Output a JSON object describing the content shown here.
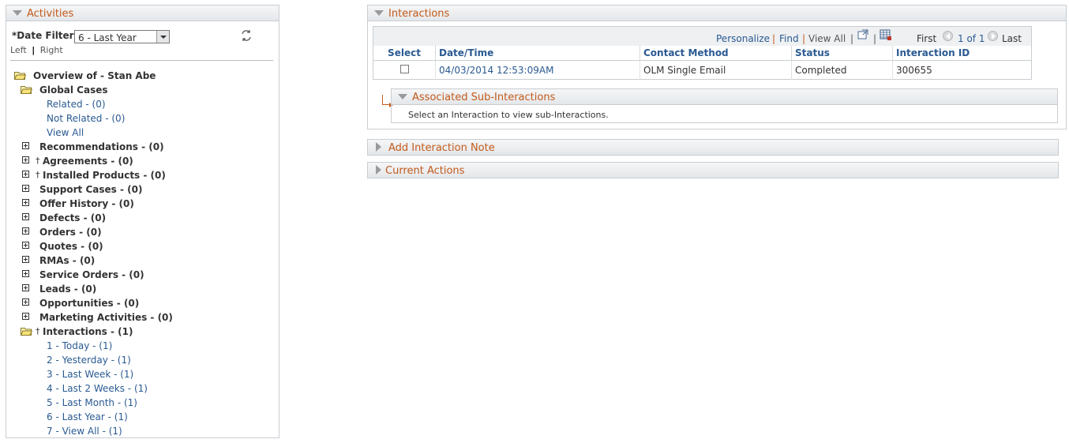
{
  "activities": {
    "title": "Activities",
    "date_filter_label": "*Date Filter",
    "date_filter_value": "6 - Last Year",
    "nav_left": "Left",
    "nav_sep": "|",
    "nav_right": "Right",
    "overview": "Overview of - Stan Abe",
    "global_cases": "Global Cases",
    "global_children": [
      "Related - (0)",
      "Not Related - (0)",
      "View All"
    ],
    "nodes": [
      "Recommendations - (0)",
      "Agreements - (0)",
      "Installed Products - (0)",
      "Support Cases - (0)",
      "Offer History - (0)",
      "Defects - (0)",
      "Orders - (0)",
      "Quotes - (0)",
      "RMAs - (0)",
      "Service Orders - (0)",
      "Leads - (0)",
      "Opportunities - (0)",
      "Marketing Activities - (0)"
    ],
    "interactions_node": "Interactions - (1)",
    "interaction_children": [
      "1 - Today - (1)",
      "2 - Yesterday - (1)",
      "3 - Last Week - (1)",
      "4 - Last 2 Weeks - (1)",
      "5 - Last Month - (1)",
      "6 - Last Year - (1)",
      "7 - View All - (1)"
    ],
    "dagger": "†"
  },
  "interactions": {
    "title": "Interactions",
    "nav": {
      "personalize": "Personalize",
      "sep": "|",
      "find": "Find",
      "view_all": "View All",
      "first": "First",
      "page": "1 of 1",
      "last": "Last"
    },
    "columns": [
      "Select",
      "Date/Time",
      "Contact Method",
      "Status",
      "Interaction ID"
    ],
    "row": {
      "datetime": "04/03/2014 12:53:09AM",
      "contact_method": "OLM Single Email",
      "status": "Completed",
      "interaction_id": "300655"
    },
    "sub": {
      "title": "Associated Sub-Interactions",
      "message": "Select an Interaction to view sub-Interactions."
    }
  },
  "add_note": {
    "title": "Add Interaction Note"
  },
  "current_actions": {
    "title": "Current Actions"
  }
}
